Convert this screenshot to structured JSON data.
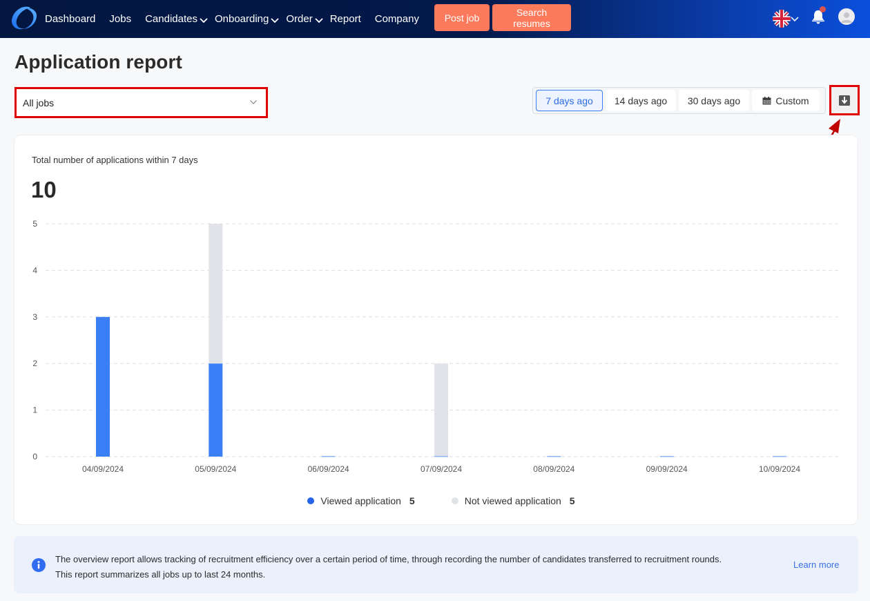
{
  "nav": {
    "items": [
      {
        "label": "Dashboard",
        "has_dropdown": false
      },
      {
        "label": "Jobs",
        "has_dropdown": false
      },
      {
        "label": "Candidates",
        "has_dropdown": true
      },
      {
        "label": "Onboarding",
        "has_dropdown": true
      },
      {
        "label": "Order",
        "has_dropdown": true
      },
      {
        "label": "Report",
        "has_dropdown": false
      },
      {
        "label": "Company",
        "has_dropdown": false
      }
    ],
    "post_job": "Post job",
    "search_resumes": "Search resumes",
    "language_icon": "uk-flag-icon",
    "notification_icon": "bell-icon",
    "profile_icon": "user-avatar-icon"
  },
  "page": {
    "title": "Application report"
  },
  "filters": {
    "job_select_value": "All jobs",
    "ranges": [
      {
        "label": "7 days ago",
        "active": true
      },
      {
        "label": "14 days ago",
        "active": false
      },
      {
        "label": "30 days ago",
        "active": false
      },
      {
        "label": "Custom",
        "active": false,
        "icon": "calendar-icon"
      }
    ],
    "download_icon": "download-icon"
  },
  "summary": {
    "subtitle": "Total number of applications within 7 days",
    "total": "10"
  },
  "colors": {
    "viewed": "#3b7ff7",
    "not_viewed": "#e1e3e8",
    "accent": "#2b6be6",
    "orange_button": "#fb7a5b",
    "annotation_red": "#e00000"
  },
  "chart_data": {
    "type": "bar",
    "stacked": true,
    "title": "Total number of applications within 7 days",
    "xlabel": "",
    "ylabel": "",
    "ylim": [
      0,
      5
    ],
    "yticks": [
      "0",
      "1",
      "2",
      "3",
      "4",
      "5"
    ],
    "grid": true,
    "legend_position": "bottom-center",
    "categories": [
      "04/09/2024",
      "05/09/2024",
      "06/09/2024",
      "07/09/2024",
      "08/09/2024",
      "09/09/2024",
      "10/09/2024"
    ],
    "series": [
      {
        "name": "Viewed application",
        "total": "5",
        "color": "#3b7ff7",
        "values": [
          3,
          2,
          0,
          0,
          0,
          0,
          0
        ]
      },
      {
        "name": "Not viewed application",
        "total": "5",
        "color": "#e1e3e8",
        "values": [
          0,
          3,
          0,
          2,
          0,
          0,
          0
        ]
      }
    ]
  },
  "info": {
    "line1": "The overview report allows tracking of recruitment efficiency over a certain period of time, through recording the number of candidates transferred to recruitment rounds.",
    "line2": "This report summarizes all jobs up to last 24 months.",
    "learn_more": "Learn more",
    "icon": "info-icon"
  }
}
